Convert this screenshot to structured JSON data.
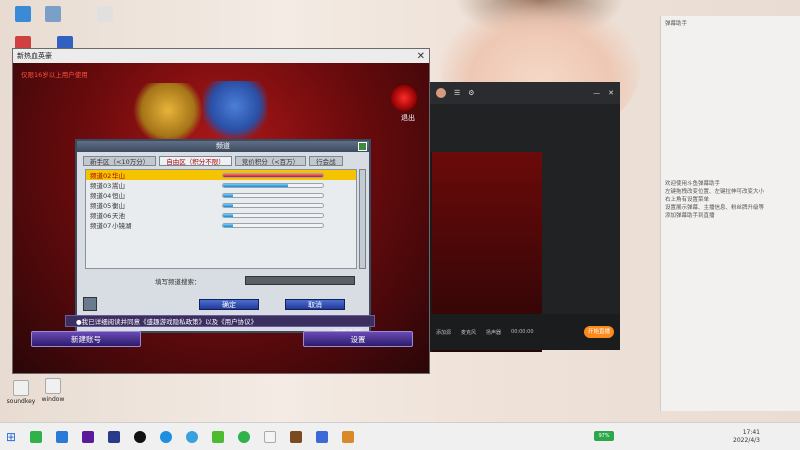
{
  "game_window": {
    "title": "新热血英豪",
    "notice": "仅限16岁以上用户使用",
    "exit_label": "退出",
    "edit_label": "编辑造型",
    "dialog": {
      "title": "频道",
      "tabs": [
        "新手区（<10万分）",
        "自由区（积分不限）",
        "竞价积分（<百万）",
        "行会战"
      ],
      "rows": [
        {
          "ch": "频道02",
          "name": "华山",
          "fill": 1.0,
          "selected": true,
          "red": true
        },
        {
          "ch": "频道03",
          "name": "嵩山",
          "fill": 0.65,
          "selected": false,
          "red": false
        },
        {
          "ch": "频道04",
          "name": "恒山",
          "fill": 0.1,
          "selected": false,
          "red": false
        },
        {
          "ch": "频道05",
          "name": "衡山",
          "fill": 0.1,
          "selected": false,
          "red": false
        },
        {
          "ch": "频道06",
          "name": "天池",
          "fill": 0.1,
          "selected": false,
          "red": false
        },
        {
          "ch": "频道07",
          "name": "小镜湖",
          "fill": 0.1,
          "selected": false,
          "red": false
        }
      ],
      "search_label": "填写频道搜索：",
      "confirm": "确定",
      "cancel": "取消"
    },
    "agree_text": "●我已详细阅读并同意《盛趣游戏隐私政策》以及《用户协议》",
    "new_account": "新建账号",
    "settings": "设置"
  },
  "streamer": {
    "bottom_labels": [
      "添加源",
      "麦克风",
      "扬声器"
    ],
    "live_button": "开始直播",
    "time": "00:00:00"
  },
  "chat": {
    "header": "弹幕助手",
    "lines": [
      "欢迎使用斗鱼弹幕助手",
      "左键拖拽改变位置、左键拉伸可改变大小",
      "右上角有设置菜单",
      "设置展示弹幕、主播信息、粉丝牌升级等",
      "添加弹幕助手到直播"
    ]
  },
  "taskbar": {
    "battery": "97%",
    "time": "17:41",
    "date": "2022/4/3"
  },
  "desktop_icons": [
    "soundkey",
    "window"
  ]
}
